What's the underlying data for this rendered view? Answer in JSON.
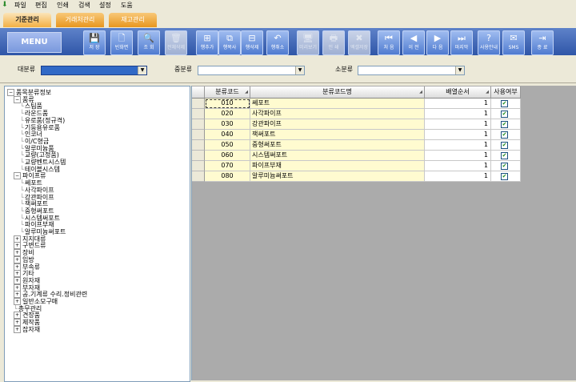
{
  "menubar": {
    "items": [
      "파일",
      "편집",
      "인쇄",
      "검색",
      "설정",
      "도움"
    ]
  },
  "tabs": [
    {
      "label": "기준관리",
      "active": true
    },
    {
      "label": "거래처관리",
      "active": false
    },
    {
      "label": "재고관리",
      "active": false
    }
  ],
  "toolbar": {
    "menu_label": "MENU",
    "buttons": [
      {
        "label": "저 장",
        "icon": "save-icon",
        "glyph": "💾",
        "enabled": true
      },
      {
        "label": "빈화면",
        "icon": "new-page-icon",
        "glyph": "🗋",
        "enabled": true
      },
      {
        "label": "조 회",
        "icon": "search-icon",
        "glyph": "🔍",
        "enabled": true
      },
      {
        "label": "전체삭제",
        "icon": "trash-icon",
        "glyph": "🗑",
        "enabled": false
      },
      {
        "label": "행추가",
        "icon": "add-row-icon",
        "glyph": "⊞",
        "enabled": true
      },
      {
        "label": "행복사",
        "icon": "copy-row-icon",
        "glyph": "⧉",
        "enabled": true
      },
      {
        "label": "행삭제",
        "icon": "delete-row-icon",
        "glyph": "⊟",
        "enabled": true
      },
      {
        "label": "행취소",
        "icon": "undo-row-icon",
        "glyph": "↶",
        "enabled": true
      },
      {
        "label": "미리보기",
        "icon": "preview-icon",
        "glyph": "🖥",
        "enabled": false
      },
      {
        "label": "인 쇄",
        "icon": "print-icon",
        "glyph": "🖶",
        "enabled": false
      },
      {
        "label": "엑셀저장",
        "icon": "excel-icon",
        "glyph": "✖",
        "enabled": false
      },
      {
        "label": "처 음",
        "icon": "first-icon",
        "glyph": "⏮",
        "enabled": true
      },
      {
        "label": "이 전",
        "icon": "prev-icon",
        "glyph": "◀",
        "enabled": true
      },
      {
        "label": "다 음",
        "icon": "next-icon",
        "glyph": "▶",
        "enabled": true
      },
      {
        "label": "마지막",
        "icon": "last-icon",
        "glyph": "⏭",
        "enabled": true
      },
      {
        "label": "사용안내",
        "icon": "help-icon",
        "glyph": "?",
        "enabled": true
      },
      {
        "label": "SMS",
        "icon": "sms-icon",
        "glyph": "✉",
        "enabled": true
      },
      {
        "label": "종 료",
        "icon": "exit-icon",
        "glyph": "⇥",
        "enabled": true
      }
    ]
  },
  "filters": {
    "major_label": "대분류",
    "middle_label": "중분류",
    "minor_label": "소분류"
  },
  "tree": {
    "nodes": [
      {
        "label": "품목분류정보",
        "level": 0,
        "toggle": "−"
      },
      {
        "label": "품류",
        "level": 1,
        "toggle": "−"
      },
      {
        "label": "스팀품",
        "level": 2
      },
      {
        "label": "라운드품",
        "level": 2
      },
      {
        "label": "유로품(정규격)",
        "level": 2
      },
      {
        "label": "기둥용유로품",
        "level": 2
      },
      {
        "label": "인코너",
        "level": 2
      },
      {
        "label": "이/C형금",
        "level": 2
      },
      {
        "label": "알루미늄품",
        "level": 2
      },
      {
        "label": "교량(고정품)",
        "level": 2
      },
      {
        "label": "교량벤트시스템",
        "level": 2
      },
      {
        "label": "테이블시스템",
        "level": 2
      },
      {
        "label": "파이프류",
        "level": 1,
        "toggle": "−"
      },
      {
        "label": "쎄포트",
        "level": 2
      },
      {
        "label": "사각파이프",
        "level": 2
      },
      {
        "label": "강관파이프",
        "level": 2
      },
      {
        "label": "잭써포트",
        "level": 2
      },
      {
        "label": "중형써포트",
        "level": 2
      },
      {
        "label": "시스템써포트",
        "level": 2
      },
      {
        "label": "파이프부재",
        "level": 2
      },
      {
        "label": "알루미늄써포트",
        "level": 2
      },
      {
        "label": "지지대류",
        "level": 1,
        "toggle": "+"
      },
      {
        "label": "구변드류",
        "level": 1,
        "toggle": "+"
      },
      {
        "label": "장비",
        "level": 1,
        "toggle": "+"
      },
      {
        "label": "임방",
        "level": 1,
        "toggle": "+"
      },
      {
        "label": "부속류",
        "level": 1,
        "toggle": "+"
      },
      {
        "label": "기타",
        "level": 1,
        "toggle": "+"
      },
      {
        "label": "원자재",
        "level": 1,
        "toggle": "+"
      },
      {
        "label": "부자재",
        "level": 1,
        "toggle": "+"
      },
      {
        "label": "공.기계류 수리.정비관련",
        "level": 1,
        "toggle": "+"
      },
      {
        "label": "일반소모구매",
        "level": 1,
        "toggle": "+"
      },
      {
        "label": "총무관리",
        "level": 1
      },
      {
        "label": "견장품",
        "level": 1,
        "toggle": "+"
      },
      {
        "label": "제작품",
        "level": 1,
        "toggle": "+"
      },
      {
        "label": "잡자재",
        "level": 1,
        "toggle": "+"
      }
    ]
  },
  "grid": {
    "columns": [
      "분류코드",
      "분류코드명",
      "배열순서",
      "사용여부"
    ],
    "rows": [
      {
        "code": "010",
        "name": "쎄포트",
        "seq": "1",
        "used": true
      },
      {
        "code": "020",
        "name": "사각파이프",
        "seq": "1",
        "used": true
      },
      {
        "code": "030",
        "name": "강관파이프",
        "seq": "1",
        "used": true
      },
      {
        "code": "040",
        "name": "잭써포트",
        "seq": "1",
        "used": true
      },
      {
        "code": "050",
        "name": "중형써포트",
        "seq": "1",
        "used": true
      },
      {
        "code": "060",
        "name": "시스템써포트",
        "seq": "1",
        "used": true
      },
      {
        "code": "070",
        "name": "파이프부재",
        "seq": "1",
        "used": true
      },
      {
        "code": "080",
        "name": "알루미늄써포트",
        "seq": "1",
        "used": true
      }
    ]
  }
}
